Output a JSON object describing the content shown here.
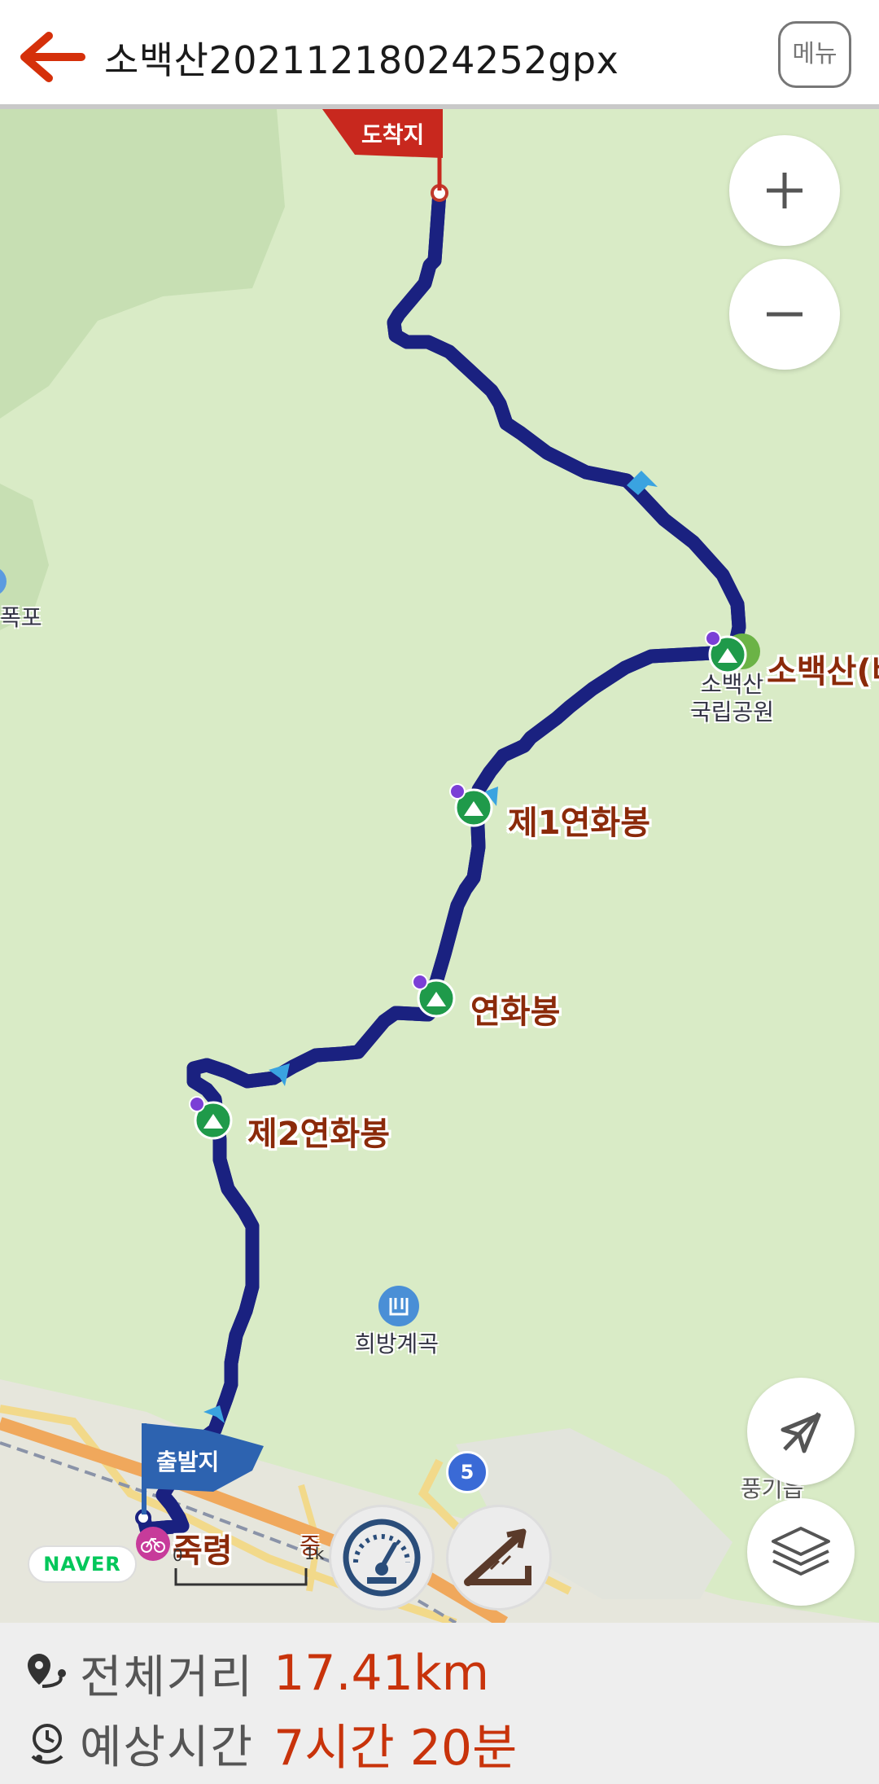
{
  "header": {
    "title": "소백산20211218024252gpx",
    "menu_label": "메뉴"
  },
  "map": {
    "end_flag_label": "도착지",
    "start_flag_label": "출발지",
    "peaks": [
      {
        "name": "소백산(비로봉)"
      },
      {
        "name": "제1연화봉"
      },
      {
        "name": "연화봉"
      },
      {
        "name": "제2연화봉"
      }
    ],
    "park_label_line1": "소백산",
    "park_label_line2": "국립공원",
    "waterfall_label": "폭포",
    "valley_label": "희방계곡",
    "pass_label": "죽령",
    "road_shield": "5",
    "place_label_right": "풍기읍",
    "scale_zero": "0",
    "scale_unit": "1k",
    "partial_road_label": "중",
    "naver_label": "NAVER",
    "route_color": "#3b3fae",
    "land_color": "#d9ebc6"
  },
  "stats": {
    "distance_label": "전체거리",
    "distance_value": "17.41km",
    "time_label": "예상시간",
    "time_value": "7시간 20분"
  }
}
